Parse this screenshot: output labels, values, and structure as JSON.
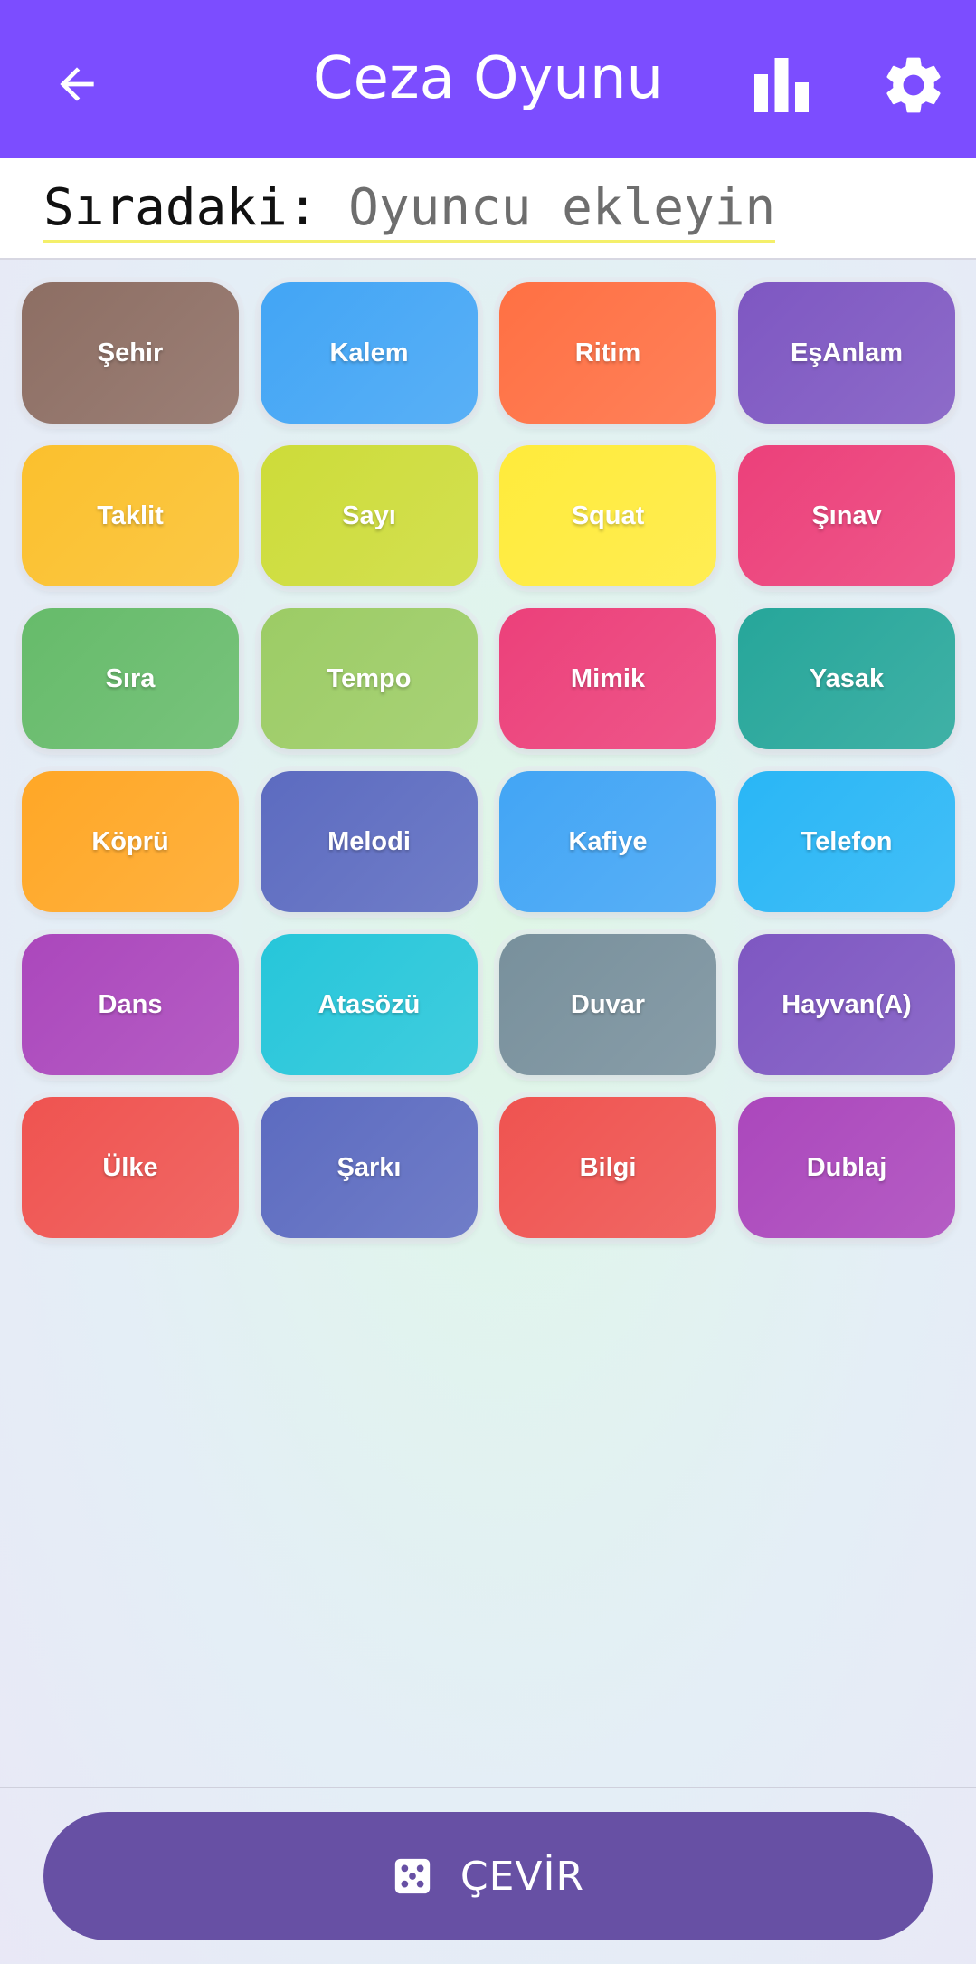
{
  "appbar": {
    "title": "Ceza Oyunu",
    "back_icon": "arrow-left-icon",
    "stats_icon": "bar-chart-icon",
    "settings_icon": "gear-icon",
    "color": "#7c4dff"
  },
  "turn": {
    "label": "Sıradaki:",
    "value": "Oyuncu ekleyin"
  },
  "tiles": [
    {
      "label": "Şehir",
      "color": "#8d6e63"
    },
    {
      "label": "Kalem",
      "color": "#42a5f5"
    },
    {
      "label": "Ritim",
      "color": "#ff7043"
    },
    {
      "label": "EşAnlam",
      "color": "#7e57c2"
    },
    {
      "label": "Taklit",
      "color": "#fbc02d"
    },
    {
      "label": "Sayı",
      "color": "#cddc39"
    },
    {
      "label": "Squat",
      "color": "#ffeb3b"
    },
    {
      "label": "Şınav",
      "color": "#ec407a"
    },
    {
      "label": "Sıra",
      "color": "#66bb6a"
    },
    {
      "label": "Tempo",
      "color": "#9ccc65"
    },
    {
      "label": "Mimik",
      "color": "#ec407a"
    },
    {
      "label": "Yasak",
      "color": "#26a69a"
    },
    {
      "label": "Köprü",
      "color": "#ffa726"
    },
    {
      "label": "Melodi",
      "color": "#5c6bc0"
    },
    {
      "label": "Kafiye",
      "color": "#42a5f5"
    },
    {
      "label": "Telefon",
      "color": "#29b6f6"
    },
    {
      "label": "Dans",
      "color": "#ab47bc"
    },
    {
      "label": "Atasözü",
      "color": "#26c6da"
    },
    {
      "label": "Duvar",
      "color": "#78909c"
    },
    {
      "label": "Hayvan(A)",
      "color": "#7e57c2"
    },
    {
      "label": "Ülke",
      "color": "#ef5350"
    },
    {
      "label": "Şarkı",
      "color": "#5c6bc0"
    },
    {
      "label": "Bilgi",
      "color": "#ef5350"
    },
    {
      "label": "Dublaj",
      "color": "#ab47bc"
    }
  ],
  "spin_button": {
    "label": "ÇEVİR",
    "icon": "dice-icon",
    "color": "#6750a4"
  }
}
